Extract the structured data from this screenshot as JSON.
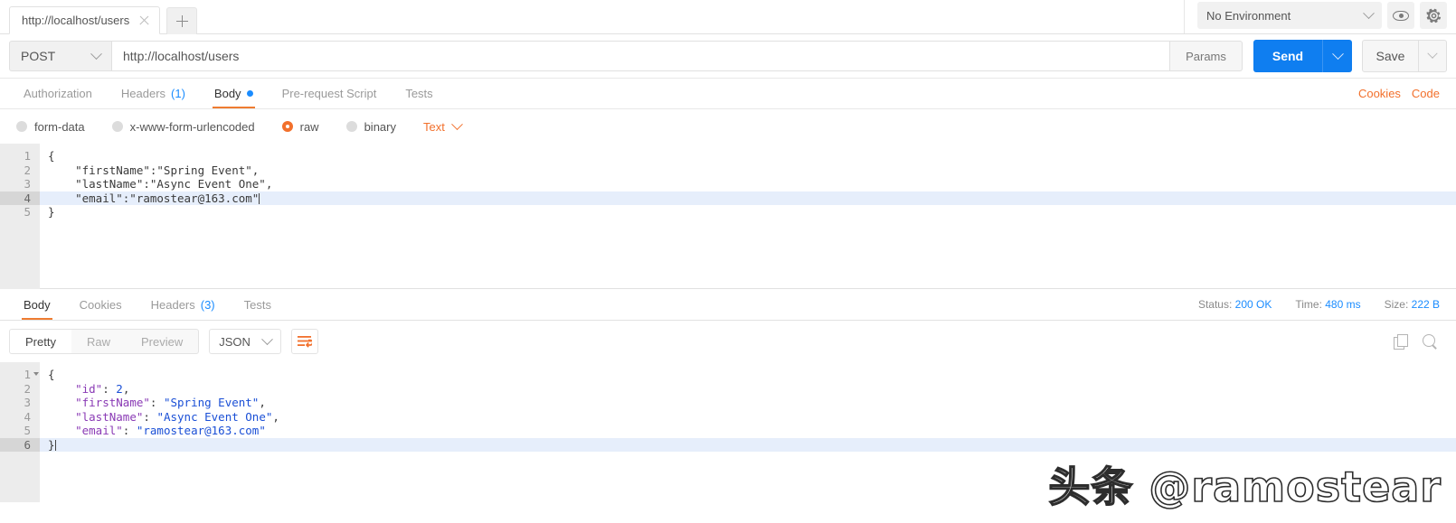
{
  "tabbar": {
    "request_tab_label": "http://localhost/users",
    "close_icon": "close-icon",
    "new_tab_icon": "plus-icon",
    "environment": {
      "selected": "No Environment",
      "chevron_icon": "chevron-down-icon"
    },
    "eye_icon": "eye-icon",
    "gear_icon": "gear-icon"
  },
  "request": {
    "method": "POST",
    "method_chevron": "chevron-down-icon",
    "url": "http://localhost/users",
    "params_label": "Params",
    "send_label": "Send",
    "send_chevron": "chevron-down-icon",
    "save_label": "Save",
    "save_chevron": "chevron-down-icon",
    "tabs": [
      {
        "label": "Authorization",
        "count": "",
        "active": false,
        "dot": false
      },
      {
        "label": "Headers",
        "count": "(1)",
        "active": false,
        "dot": false
      },
      {
        "label": "Body",
        "count": "",
        "active": true,
        "dot": true
      },
      {
        "label": "Pre-request Script",
        "count": "",
        "active": false,
        "dot": false
      },
      {
        "label": "Tests",
        "count": "",
        "active": false,
        "dot": false
      }
    ],
    "cookies_link": "Cookies",
    "code_link": "Code",
    "body_types": [
      {
        "label": "form-data",
        "selected": false
      },
      {
        "label": "x-www-form-urlencoded",
        "selected": false
      },
      {
        "label": "raw",
        "selected": true
      },
      {
        "label": "binary",
        "selected": false
      }
    ],
    "raw_format": "Text",
    "raw_format_chevron": "chevron-down-icon",
    "body_lines": [
      {
        "num": "1",
        "text": "{",
        "current": false
      },
      {
        "num": "2",
        "text": "    \"firstName\":\"Spring Event\",",
        "current": false
      },
      {
        "num": "3",
        "text": "    \"lastName\":\"Async Event One\",",
        "current": false
      },
      {
        "num": "4",
        "text": "    \"email\":\"ramostear@163.com\"",
        "current": true
      },
      {
        "num": "5",
        "text": "}",
        "current": false
      }
    ]
  },
  "response": {
    "tabs": [
      {
        "label": "Body",
        "count": "",
        "active": true
      },
      {
        "label": "Cookies",
        "count": "",
        "active": false
      },
      {
        "label": "Headers",
        "count": "(3)",
        "active": false
      },
      {
        "label": "Tests",
        "count": "",
        "active": false
      }
    ],
    "status_label": "Status:",
    "status_value": "200 OK",
    "time_label": "Time:",
    "time_value": "480 ms",
    "size_label": "Size:",
    "size_value": "222 B",
    "view_modes": [
      {
        "label": "Pretty",
        "active": true
      },
      {
        "label": "Raw",
        "active": false
      },
      {
        "label": "Preview",
        "active": false
      }
    ],
    "format": "JSON",
    "format_chevron": "chevron-down-icon",
    "wrap_icon": "word-wrap-icon",
    "copy_icon": "copy-icon",
    "search_icon": "search-icon",
    "body_lines": [
      {
        "num": "1",
        "fold": true,
        "current": false,
        "tokens": [
          {
            "t": "{",
            "c": "k-pun"
          }
        ]
      },
      {
        "num": "2",
        "fold": false,
        "current": false,
        "tokens": [
          {
            "t": "    ",
            "c": "k-pun"
          },
          {
            "t": "\"id\"",
            "c": "k-key"
          },
          {
            "t": ": ",
            "c": "k-pun"
          },
          {
            "t": "2",
            "c": "k-num"
          },
          {
            "t": ",",
            "c": "k-pun"
          }
        ]
      },
      {
        "num": "3",
        "fold": false,
        "current": false,
        "tokens": [
          {
            "t": "    ",
            "c": "k-pun"
          },
          {
            "t": "\"firstName\"",
            "c": "k-key"
          },
          {
            "t": ": ",
            "c": "k-pun"
          },
          {
            "t": "\"Spring Event\"",
            "c": "k-str"
          },
          {
            "t": ",",
            "c": "k-pun"
          }
        ]
      },
      {
        "num": "4",
        "fold": false,
        "current": false,
        "tokens": [
          {
            "t": "    ",
            "c": "k-pun"
          },
          {
            "t": "\"lastName\"",
            "c": "k-key"
          },
          {
            "t": ": ",
            "c": "k-pun"
          },
          {
            "t": "\"Async Event One\"",
            "c": "k-str"
          },
          {
            "t": ",",
            "c": "k-pun"
          }
        ]
      },
      {
        "num": "5",
        "fold": false,
        "current": false,
        "tokens": [
          {
            "t": "    ",
            "c": "k-pun"
          },
          {
            "t": "\"email\"",
            "c": "k-key"
          },
          {
            "t": ": ",
            "c": "k-pun"
          },
          {
            "t": "\"ramostear@163.com\"",
            "c": "k-str"
          }
        ]
      },
      {
        "num": "6",
        "fold": false,
        "current": true,
        "tokens": [
          {
            "t": "}",
            "c": "k-pun"
          }
        ]
      }
    ]
  },
  "watermark": {
    "text": "头条 @ramostear"
  },
  "colors": {
    "accent_blue": "#0f7ef0",
    "accent_orange": "#f2702c",
    "link_blue": "#1a8cff",
    "key_purple": "#8a3ab5",
    "string_blue": "#1a4fd6"
  }
}
